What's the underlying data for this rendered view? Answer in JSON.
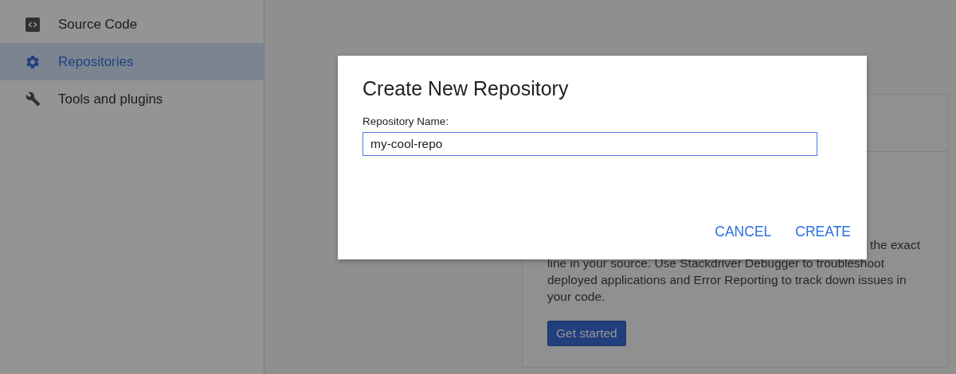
{
  "sidebar": {
    "items": [
      {
        "label": "Source Code",
        "kind": "code",
        "selected": false
      },
      {
        "label": "Repositories",
        "kind": "settings",
        "selected": true
      },
      {
        "label": "Tools and plugins",
        "kind": "tools",
        "selected": false
      }
    ]
  },
  "card": {
    "line_end": "the exact",
    "body": "line in your source. Use Stackdriver Debugger to troubleshoot deployed applications and Error Reporting to track down issues in your code.",
    "button": "Get started"
  },
  "dialog": {
    "title": "Create New Repository",
    "field_label": "Repository Name:",
    "field_value": "my-cool-repo",
    "buttons": [
      "CANCEL",
      "CREATE"
    ]
  }
}
